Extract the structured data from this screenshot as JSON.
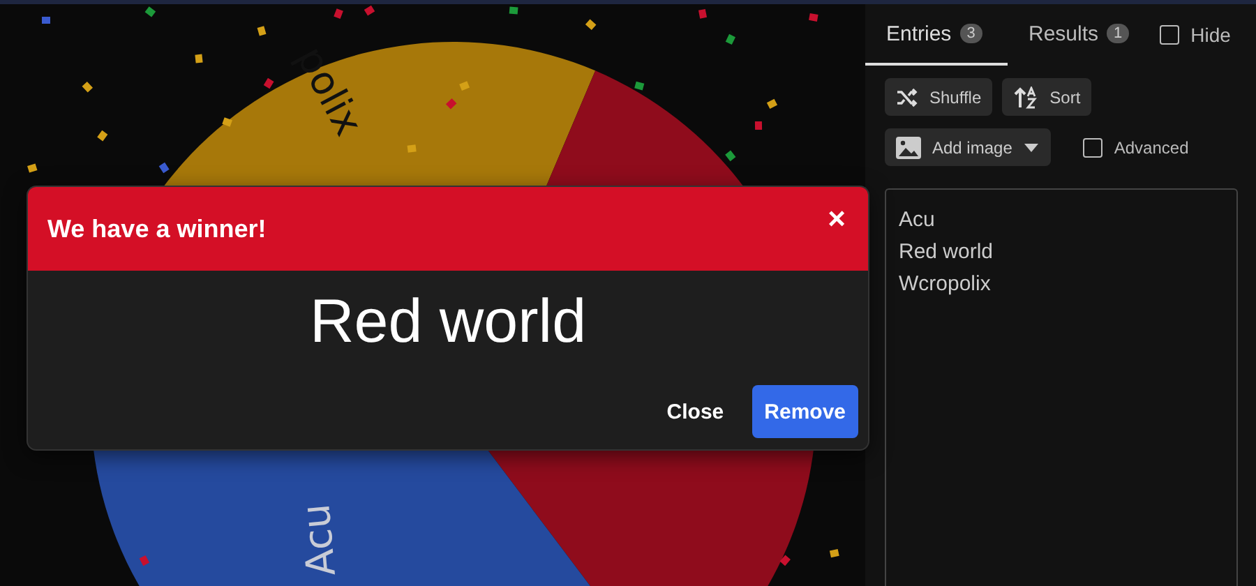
{
  "wheel": {
    "segments": [
      {
        "label": "polix",
        "color": "#a7780a"
      },
      {
        "color": "#8f0c1c"
      },
      {
        "label": "Acu",
        "color": "#254a9e"
      }
    ]
  },
  "dialog": {
    "title": "We have a winner!",
    "close_icon": "×",
    "winner": "Red world",
    "buttons": [
      {
        "label": "Close",
        "kind": "text"
      },
      {
        "label": "Remove",
        "kind": "primary"
      }
    ]
  },
  "tabs": [
    {
      "label": "Entries",
      "count": "3",
      "selected": true
    },
    {
      "label": "Results",
      "count": "1",
      "selected": false
    }
  ],
  "hide": {
    "label": "Hide",
    "checked": false
  },
  "tools": [
    {
      "label": "Shuffle",
      "kind": "shuffle"
    },
    {
      "label": "Sort",
      "kind": "sort"
    }
  ],
  "add_image": {
    "label": "Add image"
  },
  "advanced": {
    "label": "Advanced",
    "checked": false
  },
  "entries": [
    "Acu",
    "Red world",
    "Wcropolix"
  ]
}
